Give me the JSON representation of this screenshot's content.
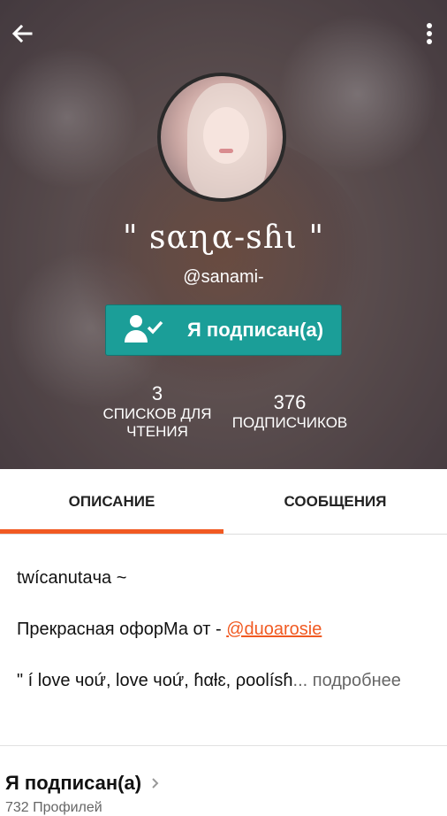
{
  "profile": {
    "name": "\" ꜱαɳα-ꜱɦι \"",
    "handle": "@sanami-",
    "follow_label": "Я подписан(а)"
  },
  "stats": [
    {
      "value": "3",
      "label_line1": "СПИСКОВ ДЛЯ",
      "label_line2": "ЧТЕНИЯ"
    },
    {
      "value": "376",
      "label_line1": "ПОДПИСЧИКОВ",
      "label_line2": ""
    }
  ],
  "tabs": [
    {
      "label": "ОПИСАНИЕ",
      "active": true
    },
    {
      "label": "СООБЩЕНИЯ",
      "active": false
    }
  ],
  "description": {
    "line1": "twícanutaчa ~",
    "line2_text": "Прекрасная офорМа от - ",
    "line2_link": "@duoarosie",
    "line3_text": "\" í love чoứ, love чoứ, ɦαƚɛ, ρoolíѕɦ",
    "line3_more": "... подробнее"
  },
  "following": {
    "title": "Я подписан(а)",
    "subtitle": "732 Профилей"
  },
  "colors": {
    "accent": "#f15a22",
    "follow_button": "#1b9e98"
  }
}
